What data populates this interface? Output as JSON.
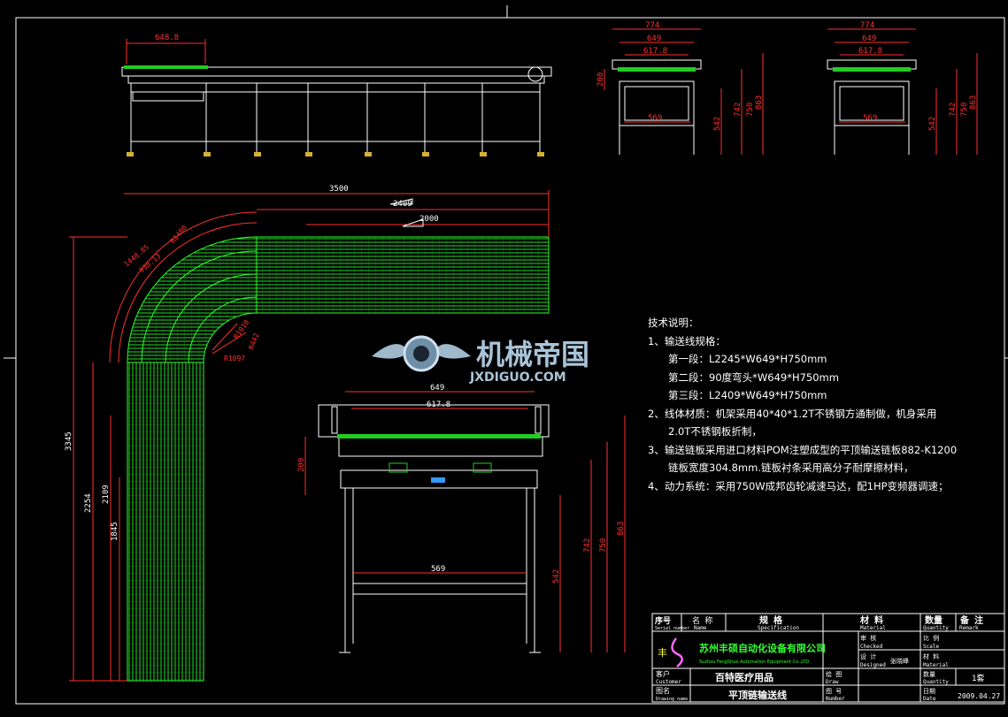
{
  "watermark": {
    "brand": "机械帝国",
    "url": "JXDIGUO.COM"
  },
  "dims": {
    "top_left_width": "648.8",
    "side_total": "774",
    "side_mid": "649",
    "side_inner": "617.8",
    "side_leg": "569",
    "h200": "200",
    "h542": "542",
    "h742": "742",
    "h750": "750",
    "h863": "863",
    "plan_3500": "3500",
    "plan_2409": "2409",
    "plan_2000": "2000",
    "plan_3345": "3345",
    "plan_2254": "2254",
    "plan_2109": "2109",
    "plan_1845": "1845",
    "arc_outer": "1448.85",
    "arc_mid": "938.13",
    "arc_r1": "R1480",
    "r_442": "R442",
    "r_1097": "R1097",
    "r_1010": "R1010",
    "front_649": "649",
    "front_617": "617.8",
    "front_569": "569",
    "front_200": "200",
    "front_542": "542",
    "front_742": "742",
    "front_750": "750",
    "front_863": "863"
  },
  "notes": {
    "title": "技术说明：",
    "l1": "1、输送线规格：",
    "l1a": "第一段：L2245*W649*H750mm",
    "l1b": "第二段：90度弯头*W649*H750mm",
    "l1c": "第三段：L2409*W649*H750mm",
    "l2": "2、线体材质：机架采用40*40*1.2T不锈钢方通制做，机身采用",
    "l2b": "2.0T不锈钢板折制，",
    "l3": "3、输送链板采用进口材料POM注塑成型的平顶输送链板882-K1200",
    "l3b": "链板宽度304.8mm.链板衬条采用高分子耐摩擦材料，",
    "l4": "4、动力系统：采用750W成邦齿轮减速马达，配1HP变频器调速；"
  },
  "title_block": {
    "seq": "序号",
    "seq_en": "Serial number",
    "name": "名 称",
    "name_en": "Name",
    "spec": "规 格",
    "spec_en": "Specification",
    "material": "材 料",
    "material_en": "Material",
    "qty": "数量",
    "qty_en": "Quantity",
    "remark": "备 注",
    "remark_en": "Remark",
    "company": "苏州丰硕自动化设备有限公司",
    "company_en": "Suzhou FengShuo Automation Equipment Co.,LTD",
    "checked": "审 核",
    "checked_en": "Checked",
    "scale": "比 例",
    "scale_en": "Scale",
    "designed": "设 计",
    "designed_en": "Designed",
    "designer": "张晓峰",
    "material2": "材 料",
    "material2_en": "Material",
    "customer": "客户",
    "customer_en": "Customer",
    "customer_val": "百特医疗用品",
    "drawing": "绘 图",
    "drawing_en": "Draw",
    "qty2": "数量",
    "qty2_en": "Quantity",
    "qty2_val": "1套",
    "figname": "图名",
    "figname_en": "Drawing name",
    "figname_val": "平顶链输送线",
    "number": "图 号",
    "number_en": "Number",
    "date": "日期",
    "date_en": "Date",
    "date_val": "2009.04.27"
  }
}
